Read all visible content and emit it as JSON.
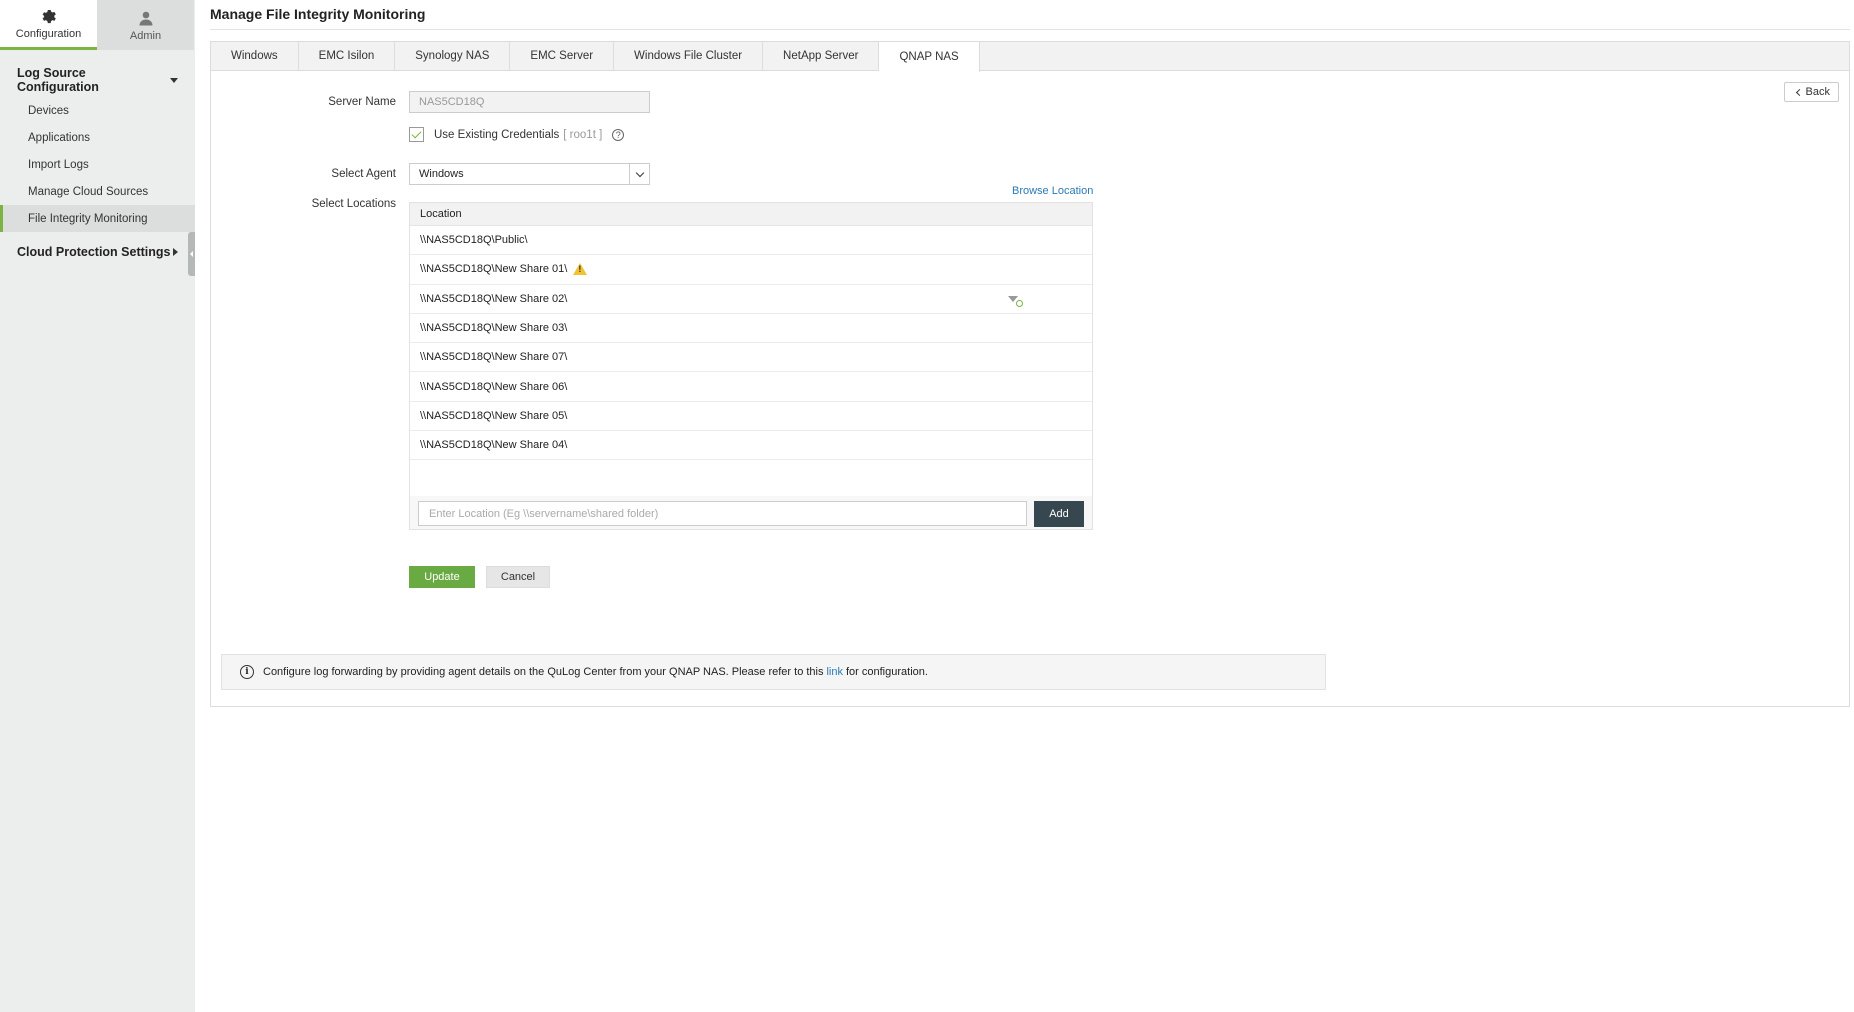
{
  "sidebar": {
    "tabs": [
      {
        "label": "Configuration",
        "icon": "gear-icon"
      },
      {
        "label": "Admin",
        "icon": "user-icon"
      }
    ],
    "group_log_source": "Log Source Configuration",
    "items": [
      {
        "label": "Devices"
      },
      {
        "label": "Applications"
      },
      {
        "label": "Import Logs"
      },
      {
        "label": "Manage Cloud Sources"
      },
      {
        "label": "File Integrity Monitoring"
      }
    ],
    "group_cloud": "Cloud Protection Settings"
  },
  "page": {
    "title": "Manage File Integrity Monitoring"
  },
  "tabs": [
    {
      "label": "Windows"
    },
    {
      "label": "EMC Isilon"
    },
    {
      "label": "Synology NAS"
    },
    {
      "label": "EMC Server"
    },
    {
      "label": "Windows File Cluster"
    },
    {
      "label": "NetApp Server"
    },
    {
      "label": "QNAP NAS"
    }
  ],
  "form": {
    "back_label": "Back",
    "server_name_label": "Server Name",
    "server_name_value": "NAS5CD18Q",
    "use_existing_credentials_label": "Use Existing Credentials",
    "credentials_user": "[ roo1t ]",
    "help_glyph": "?",
    "select_agent_label": "Select Agent",
    "select_agent_value": "Windows",
    "browse_location_label": "Browse Location",
    "select_locations_label": "Select Locations",
    "location_header": "Location",
    "locations": [
      "\\\\NAS5CD18Q\\Public\\",
      "\\\\NAS5CD18Q\\New Share 01\\",
      "\\\\NAS5CD18Q\\New Share 02\\",
      "\\\\NAS5CD18Q\\New Share 03\\",
      "\\\\NAS5CD18Q\\New Share 07\\",
      "\\\\NAS5CD18Q\\New Share 06\\",
      "\\\\NAS5CD18Q\\New Share 05\\",
      "\\\\NAS5CD18Q\\New Share 04\\"
    ],
    "location_input_placeholder": "Enter Location (Eg \\\\servername\\shared folder)",
    "add_label": "Add",
    "update_label": "Update",
    "cancel_label": "Cancel"
  },
  "info": {
    "glyph": "i",
    "text_before": "Configure log forwarding by providing agent details on the QuLog Center from your QNAP NAS. Please refer to this",
    "link_text": "link",
    "text_after": "for configuration."
  },
  "colors": {
    "accent_green": "#7cb342",
    "link_blue": "#2a7ab5",
    "warning_yellow": "#f2c231",
    "add_button_dark": "#37474f"
  }
}
